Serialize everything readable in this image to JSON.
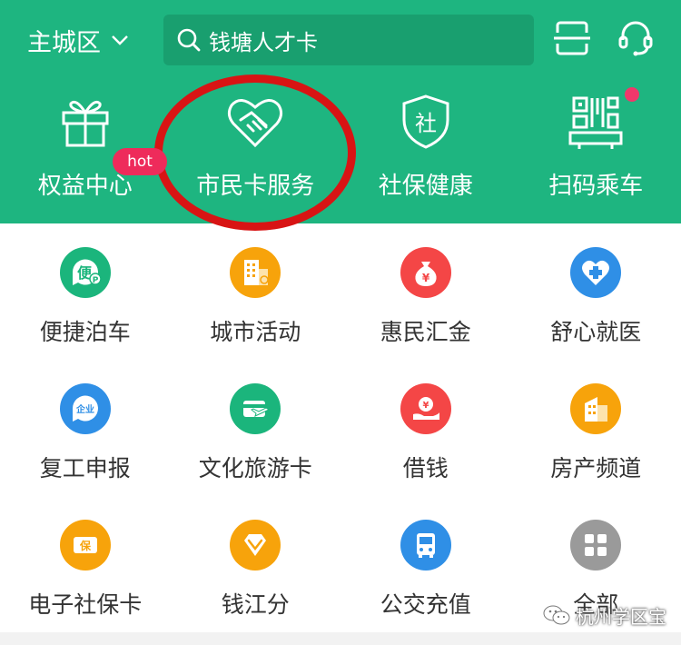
{
  "header": {
    "district": "主城区",
    "search_placeholder": "钱塘人才卡"
  },
  "quick_actions": [
    {
      "label": "权益中心",
      "icon": "gift-icon"
    },
    {
      "label": "市民卡服务",
      "icon": "handshake-heart-icon"
    },
    {
      "label": "社保健康",
      "icon": "shield-icon",
      "glyph": "社"
    },
    {
      "label": "扫码乘车",
      "icon": "qr-code-icon",
      "has_dot": true
    }
  ],
  "grid": [
    {
      "label": "便捷泊车",
      "icon": "parking-icon",
      "color": "#1bb57c",
      "glyph": "便"
    },
    {
      "label": "城市活动",
      "icon": "building-icon",
      "color": "#f7a30b"
    },
    {
      "label": "惠民汇金",
      "icon": "money-bag-icon",
      "color": "#f44646"
    },
    {
      "label": "舒心就医",
      "icon": "medical-icon",
      "color": "#2f8fe6"
    },
    {
      "label": "复工申报",
      "icon": "enterprise-icon",
      "color": "#2f8fe6",
      "glyph": "企业",
      "badge": "hot"
    },
    {
      "label": "文化旅游卡",
      "icon": "travel-card-icon",
      "color": "#1bb57c"
    },
    {
      "label": "借钱",
      "icon": "borrow-money-icon",
      "color": "#f44646"
    },
    {
      "label": "房产频道",
      "icon": "house-icon",
      "color": "#f7a30b"
    },
    {
      "label": "电子社保卡",
      "icon": "social-card-icon",
      "color": "#f7a30b",
      "glyph": "保"
    },
    {
      "label": "钱江分",
      "icon": "diamond-icon",
      "color": "#f7a30b"
    },
    {
      "label": "公交充值",
      "icon": "bus-icon",
      "color": "#2f8fe6"
    },
    {
      "label": "全部",
      "icon": "all-apps-icon",
      "color": "#9a9a9a"
    }
  ],
  "watermark": "杭州学区宝"
}
